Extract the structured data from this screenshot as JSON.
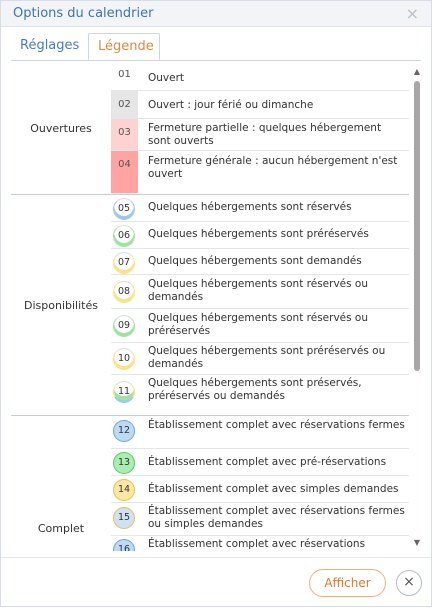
{
  "dialog": {
    "title": "Options du calendrier",
    "close_icon": "×"
  },
  "tabs": [
    {
      "label": "Réglages"
    },
    {
      "label": "Légende"
    }
  ],
  "groups": [
    {
      "label": "Ouvertures"
    },
    {
      "label": "Disponibilités"
    },
    {
      "label": "Complet"
    }
  ],
  "rows": [
    {
      "code": "01",
      "text": "Ouvert",
      "bg": "#ffffff"
    },
    {
      "code": "02",
      "text": "Ouvert : jour férié ou dimanche",
      "bg": "#e6e6e6"
    },
    {
      "code": "03",
      "text": "Fermeture partielle : quelques hébergement sont ouverts",
      "bg": "#ffd2d2"
    },
    {
      "code": "04",
      "text": "Fermeture générale : aucun hébergement n'est ouvert",
      "bg": "#ffa3a3"
    },
    {
      "code": "05",
      "text": "Quelques hébergements sont réservés",
      "color": "#9ec8ef"
    },
    {
      "code": "06",
      "text": "Quelques hébergements sont préréservés",
      "color": "#9fe39f"
    },
    {
      "code": "07",
      "text": "Quelques hébergements sont demandés",
      "color": "#f7e38a"
    },
    {
      "code": "08",
      "text": "Quelques hébergements sont réservés ou demandés",
      "color": "#9ec8ef",
      "color2": "#f7e38a"
    },
    {
      "code": "09",
      "text": "Quelques hébergements sont réservés ou préréservés",
      "color": "#9ec8ef",
      "color2": "#9fe39f"
    },
    {
      "code": "10",
      "text": "Quelques hébergements sont préréservés ou demandés",
      "color": "#9fe39f",
      "color2": "#f7e38a"
    },
    {
      "code": "11",
      "text": "Quelques hébergements sont préservés, préréservés ou demandés",
      "color": "#9ec8ef",
      "color2": "#9fe39f",
      "color3": "#f7e38a"
    },
    {
      "code": "12",
      "text": "Établissement complet avec réservations fermes",
      "fill": "#bcd9f5",
      "border": "#6ea7dc"
    },
    {
      "code": "13",
      "text": "Établissement complet avec pré-réservations",
      "fill": "#a9eeb0",
      "border": "#5fc76b"
    },
    {
      "code": "14",
      "text": "Établissement complet avec simples demandes",
      "fill": "#fbe7a0",
      "border": "#e0c25a"
    },
    {
      "code": "15",
      "text": "Établissement complet avec réservations fermes ou simples demandes",
      "fill": "#cfe2f3",
      "border": "#e0c25a"
    },
    {
      "code": "16",
      "text": "Établissement complet avec réservations",
      "fill": "#bcd9f5",
      "border": "#6ea7dc"
    }
  ],
  "footer": {
    "afficher_label": "Afficher",
    "close_label": "×"
  },
  "scrollbar": {
    "up": "▲",
    "down": "▼"
  }
}
